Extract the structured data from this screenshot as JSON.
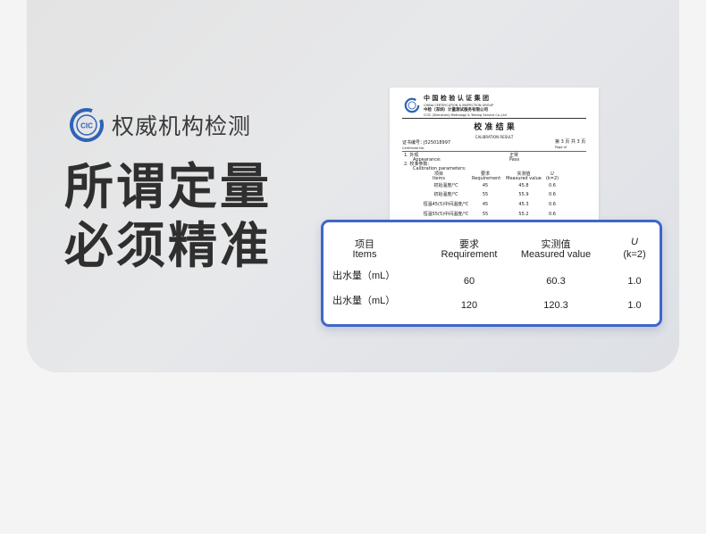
{
  "brand": {
    "label": "权威机构检测",
    "logo_text": "CIC"
  },
  "headline": {
    "line1": "所谓定量",
    "line2": "必须精准"
  },
  "certificate": {
    "org_cn": "中 国 检 验 认 证 集 团",
    "org_en": "CHINA CERTIFICATION & INSPECTION GROUP",
    "sub_cn": "中检（深圳）计量测试服务有限公司",
    "sub_en": "CCIC (Shenzhen) Metrology & Testing Service Co.,Ltd",
    "title_cn": "校 准 结 果",
    "title_en": "CALIBRATION RESULT",
    "cert_no_label": "证书编号：",
    "cert_no": "J525018997",
    "cert_no_en": "Certificate No.",
    "page_info": "第 3 页 共 3 页",
    "page_en": "Page  of",
    "item1_label": "1.  外观",
    "item1_en": "Appearance:",
    "item1_value_cn": "正常",
    "item1_value_en": "Pass",
    "item2_label": "2.  校准参数:",
    "item2_en": "Calibration parameters:",
    "columns": [
      {
        "cn": "项目",
        "en": "Items"
      },
      {
        "cn": "要求",
        "en": "Requirement"
      },
      {
        "cn": "实测值",
        "en": "Measured value"
      },
      {
        "cn": "U",
        "en": "(k=2)"
      }
    ],
    "rows": [
      {
        "item": "初始温度/℃",
        "req": "45",
        "measured": "45.8",
        "u": "0.6"
      },
      {
        "item": "初始温度/℃",
        "req": "55",
        "measured": "55.9",
        "u": "0.6"
      },
      {
        "item": "恒温45(5)中间温度/℃",
        "req": "45",
        "measured": "45.3",
        "u": "0.6"
      },
      {
        "item": "恒温55(5)中间温度/℃",
        "req": "55",
        "measured": "55.2",
        "u": "0.6"
      }
    ]
  },
  "result_card": {
    "headers": [
      {
        "cn": "项目",
        "en": "Items"
      },
      {
        "cn": "要求",
        "en": "Requirement"
      },
      {
        "cn": "实测值",
        "en": "Measured value"
      },
      {
        "cn": "U",
        "en": "(k=2)"
      }
    ],
    "rows": [
      {
        "item": "出水量（mL）",
        "req": "60",
        "measured": "60.3",
        "u": "1.0"
      },
      {
        "item": "出水量（mL）",
        "req": "120",
        "measured": "120.3",
        "u": "1.0"
      }
    ]
  },
  "colors": {
    "accent_border": "#3f67c8",
    "logo_blue": "#2f63b8",
    "headline": "#2f2f2f"
  }
}
